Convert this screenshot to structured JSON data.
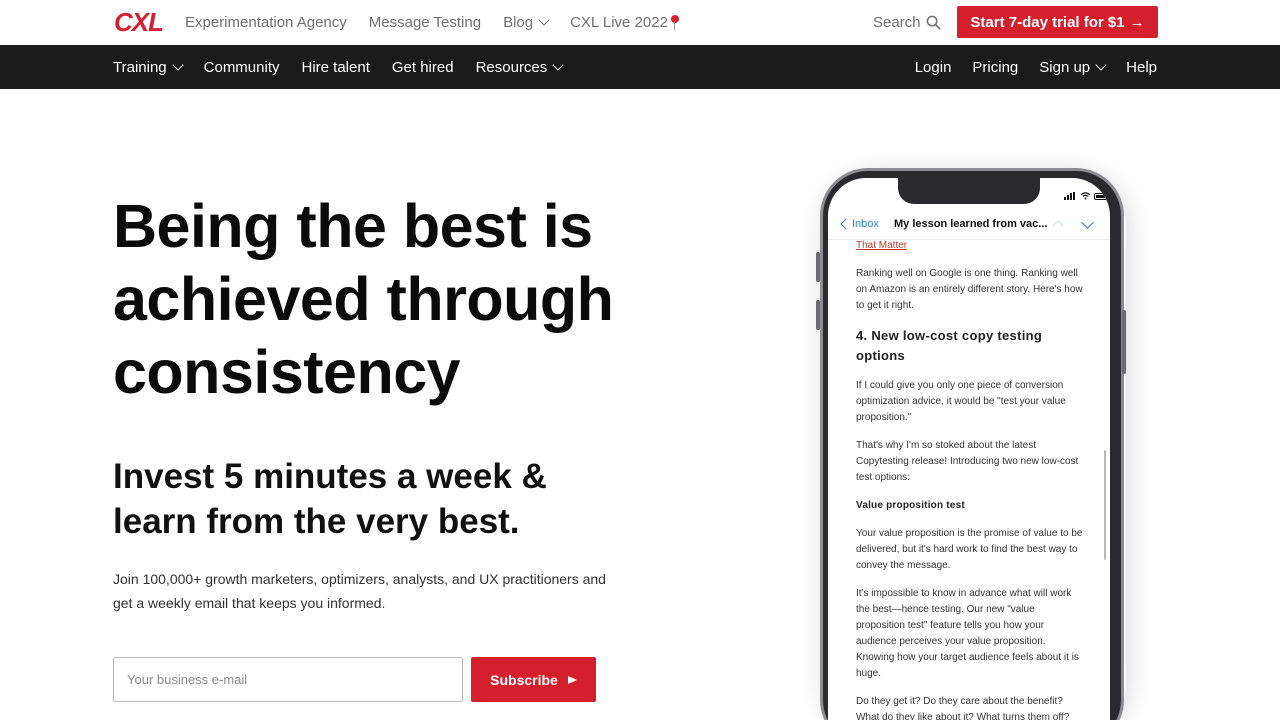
{
  "brand": {
    "logo_text": "CXL",
    "accent": "#d61f2c"
  },
  "topnav": {
    "items": [
      {
        "label": "Experimentation Agency"
      },
      {
        "label": "Message Testing"
      },
      {
        "label": "Blog"
      },
      {
        "label": "CXL Live 2022"
      }
    ],
    "search_label": "Search",
    "trial_button": "Start 7-day trial for $1",
    "trial_arrow": "→"
  },
  "mainnav": {
    "left": [
      {
        "label": "Training"
      },
      {
        "label": "Community"
      },
      {
        "label": "Hire talent"
      },
      {
        "label": "Get hired"
      },
      {
        "label": "Resources"
      }
    ],
    "right": [
      {
        "label": "Login"
      },
      {
        "label": "Pricing"
      },
      {
        "label": "Sign up"
      },
      {
        "label": "Help"
      }
    ]
  },
  "hero": {
    "headline_1": "Being the best is",
    "headline_2": "achieved through",
    "headline_3": "consistency",
    "subhead_1": "Invest 5 minutes a week &",
    "subhead_2": "learn from the very best.",
    "description_1": "Join 100,000+ growth marketers, optimizers, analysts, and UX practitioners and",
    "description_2": "get a weekly email that keeps you informed.",
    "email_placeholder": "Your business e-mail",
    "subscribe_label": "Subscribe"
  },
  "phone_email": {
    "back_label": "Inbox",
    "subject": "My lesson learned from vac...",
    "link_text": "That Matter",
    "para_1": "Ranking well on Google is one thing. Ranking well on Amazon is an entirely different story. Here's how to get it right.",
    "heading": "4. New low-cost copy testing options",
    "para_2": "If I could give you only one piece of conversion optimization advice, it would be \"test your value proposition.\"",
    "para_3": "That's why I'm so stoked about the latest Copytesting release! Introducing two new low-cost test options:",
    "subheading": "Value proposition test",
    "para_4": "Your value proposition is the promise of value to be delivered, but it's hard work to find the best way to convey the message.",
    "para_5": "It's impossible to know in advance what will work the best—hence testing. Our new \"value proposition test\" feature tells you how your audience perceives your value proposition. Knowing how your target audience feels about it is huge.",
    "para_6": "Do they get it? Do they care about the benefit? What do they like about it? What turns them off?"
  }
}
